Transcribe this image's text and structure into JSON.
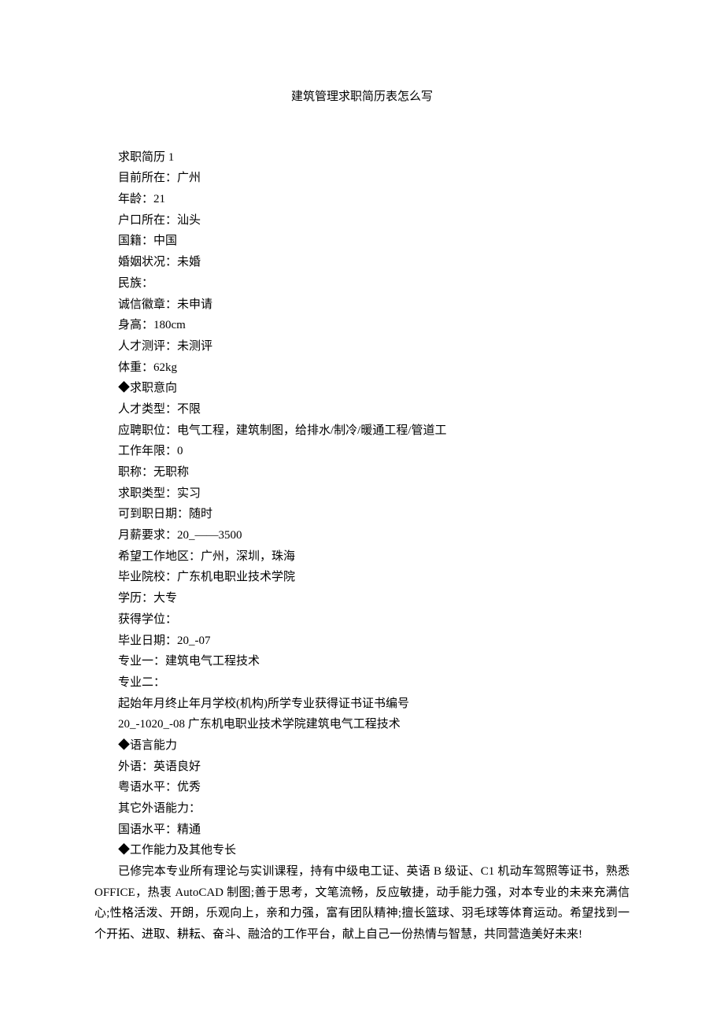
{
  "title": "建筑管理求职简历表怎么写",
  "lines": [
    "求职简历 1",
    "目前所在：广州",
    "年龄：21",
    "户口所在：汕头",
    "国籍：中国",
    "婚姻状况：未婚",
    "民族：",
    "诚信徽章：未申请",
    "身高：180cm",
    "人才测评：未测评",
    "体重：62kg",
    "◆求职意向",
    "人才类型：不限",
    "应聘职位：电气工程，建筑制图，给排水/制冷/暖通工程/管道工",
    "工作年限：0",
    "职称：无职称",
    "求职类型：实习",
    "可到职日期：随时",
    "月薪要求：20_——3500",
    "希望工作地区：广州，深圳，珠海",
    "毕业院校：广东机电职业技术学院",
    "学历：大专",
    "获得学位：",
    "毕业日期：20_-07",
    "专业一：建筑电气工程技术",
    "专业二：",
    "起始年月终止年月学校(机构)所学专业获得证书证书编号",
    "20_-1020_-08 广东机电职业技术学院建筑电气工程技术",
    "◆语言能力",
    "外语：英语良好",
    "粤语水平：优秀",
    "其它外语能力：",
    "国语水平：精通",
    "◆工作能力及其他专长"
  ],
  "paragraph": "已修完本专业所有理论与实训课程，持有中级电工证、英语 B 级证、C1 机动车驾照等证书，熟悉 OFFICE，热衷 AutoCAD 制图;善于思考，文笔流畅，反应敏捷，动手能力强，对本专业的未来充满信心;性格活泼、开朗，乐观向上，亲和力强，富有团队精神;擅长篮球、羽毛球等体育运动。希望找到一个开拓、进取、耕耘、奋斗、融洽的工作平台，献上自己一份热情与智慧，共同营造美好未来!"
}
